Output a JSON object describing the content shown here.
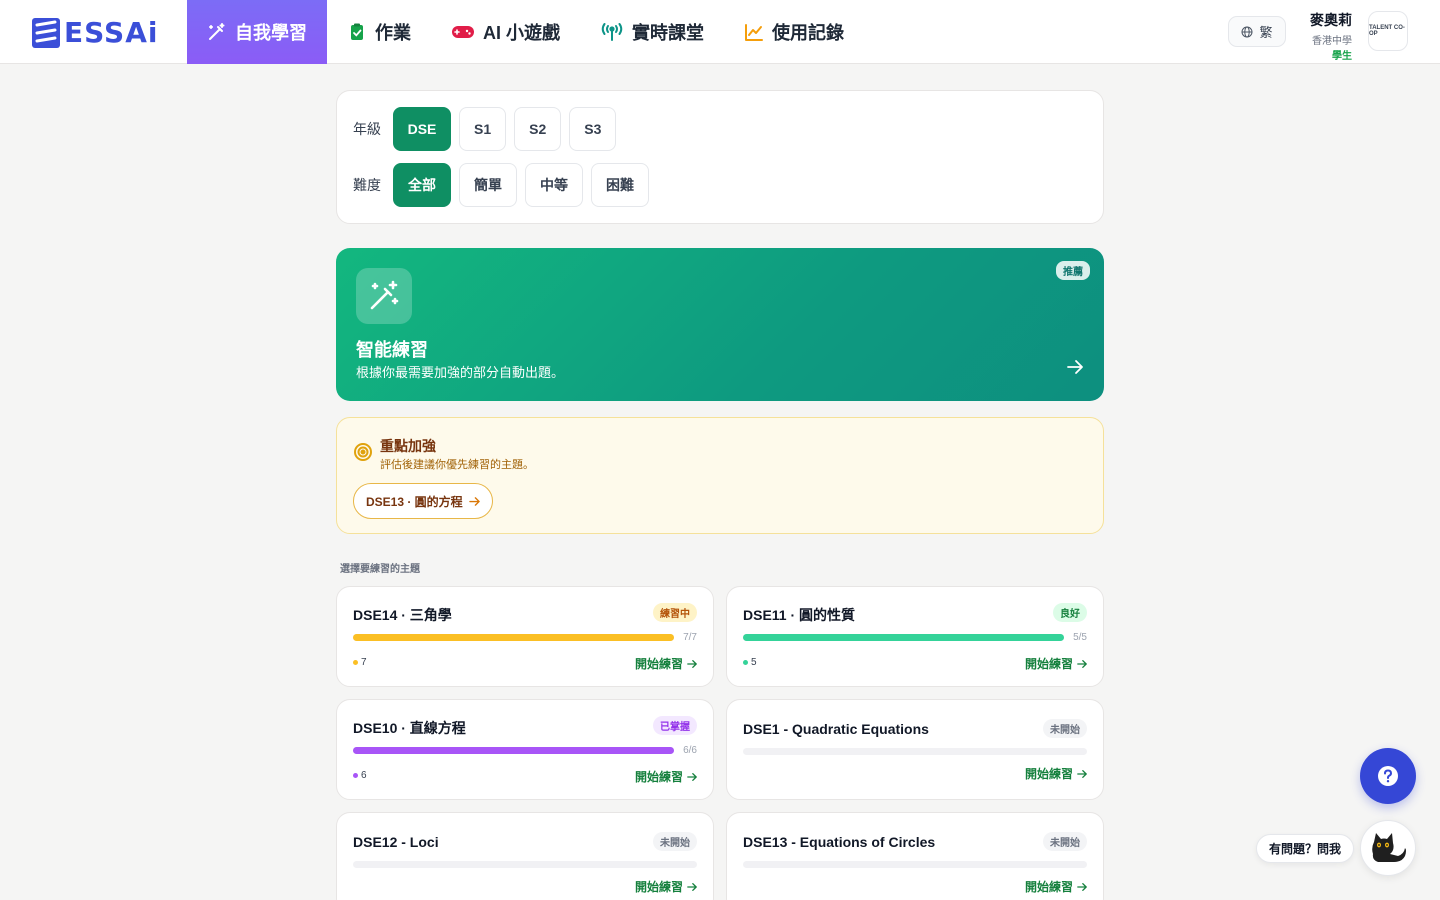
{
  "brand": {
    "logo_text": "ESSAi"
  },
  "nav": {
    "items": [
      {
        "label": "自我學習",
        "active": true
      },
      {
        "label": "作業",
        "active": false
      },
      {
        "label": "AI 小遊戲",
        "active": false
      },
      {
        "label": "實時課堂",
        "active": false
      },
      {
        "label": "使用記錄",
        "active": false
      }
    ]
  },
  "header": {
    "language": "繁",
    "user_name": "麥奧莉",
    "school": "香港中學",
    "role": "學生",
    "avatar_text": "TALENT CO-OP"
  },
  "filters": {
    "grade_label": "年級",
    "grades": [
      {
        "label": "DSE",
        "active": true
      },
      {
        "label": "S1",
        "active": false
      },
      {
        "label": "S2",
        "active": false
      },
      {
        "label": "S3",
        "active": false
      }
    ],
    "difficulty_label": "難度",
    "difficulties": [
      {
        "label": "全部",
        "active": true
      },
      {
        "label": "簡單",
        "active": false
      },
      {
        "label": "中等",
        "active": false
      },
      {
        "label": "困難",
        "active": false
      }
    ]
  },
  "smart": {
    "badge": "推薦",
    "title": "智能練習",
    "description": "根據你最需要加強的部分自動出題。"
  },
  "focus": {
    "title": "重點加強",
    "description": "評估後建議你優先練習的主題。",
    "topic": "DSE13 · 圓的方程"
  },
  "section_label": "選擇要練習的主題",
  "topics": [
    {
      "title": "DSE14 · 三角學",
      "badge": "練習中",
      "badge_bg": "#fef3c7",
      "badge_color": "#b45309",
      "progress": 1.0,
      "count": "7/7",
      "dots": "7",
      "color": "#fbbf24",
      "start": "開始練習"
    },
    {
      "title": "DSE11 · 圓的性質",
      "badge": "良好",
      "badge_bg": "#dcfce7",
      "badge_color": "#15803d",
      "progress": 1.0,
      "count": "5/5",
      "dots": "5",
      "color": "#34d399",
      "start": "開始練習"
    },
    {
      "title": "DSE10 · 直線方程",
      "badge": "已掌握",
      "badge_bg": "#f3e8ff",
      "badge_color": "#9333ea",
      "progress": 1.0,
      "count": "6/6",
      "dots": "6",
      "color": "#a855f7",
      "start": "開始練習"
    },
    {
      "title": "DSE1 - Quadratic Equations",
      "badge": "未開始",
      "badge_bg": "#f3f4f6",
      "badge_color": "#6b7280",
      "progress": 0,
      "count": "",
      "dots": "",
      "color": "#e5e7eb",
      "start": "開始練習"
    },
    {
      "title": "DSE12 - Loci",
      "badge": "未開始",
      "badge_bg": "#f3f4f6",
      "badge_color": "#6b7280",
      "progress": 0,
      "count": "",
      "dots": "",
      "color": "#e5e7eb",
      "start": "開始練習"
    },
    {
      "title": "DSE13 - Equations of Circles",
      "badge": "未開始",
      "badge_bg": "#f3f4f6",
      "badge_color": "#6b7280",
      "progress": 0,
      "count": "",
      "dots": "",
      "color": "#e5e7eb",
      "start": "開始練習"
    }
  ],
  "assistant": {
    "ask_label": "有問題？問我"
  },
  "colors": {
    "primary_green": "#0f8f63",
    "nav_active": "#7c6cf6",
    "help_blue": "#3547d6"
  }
}
